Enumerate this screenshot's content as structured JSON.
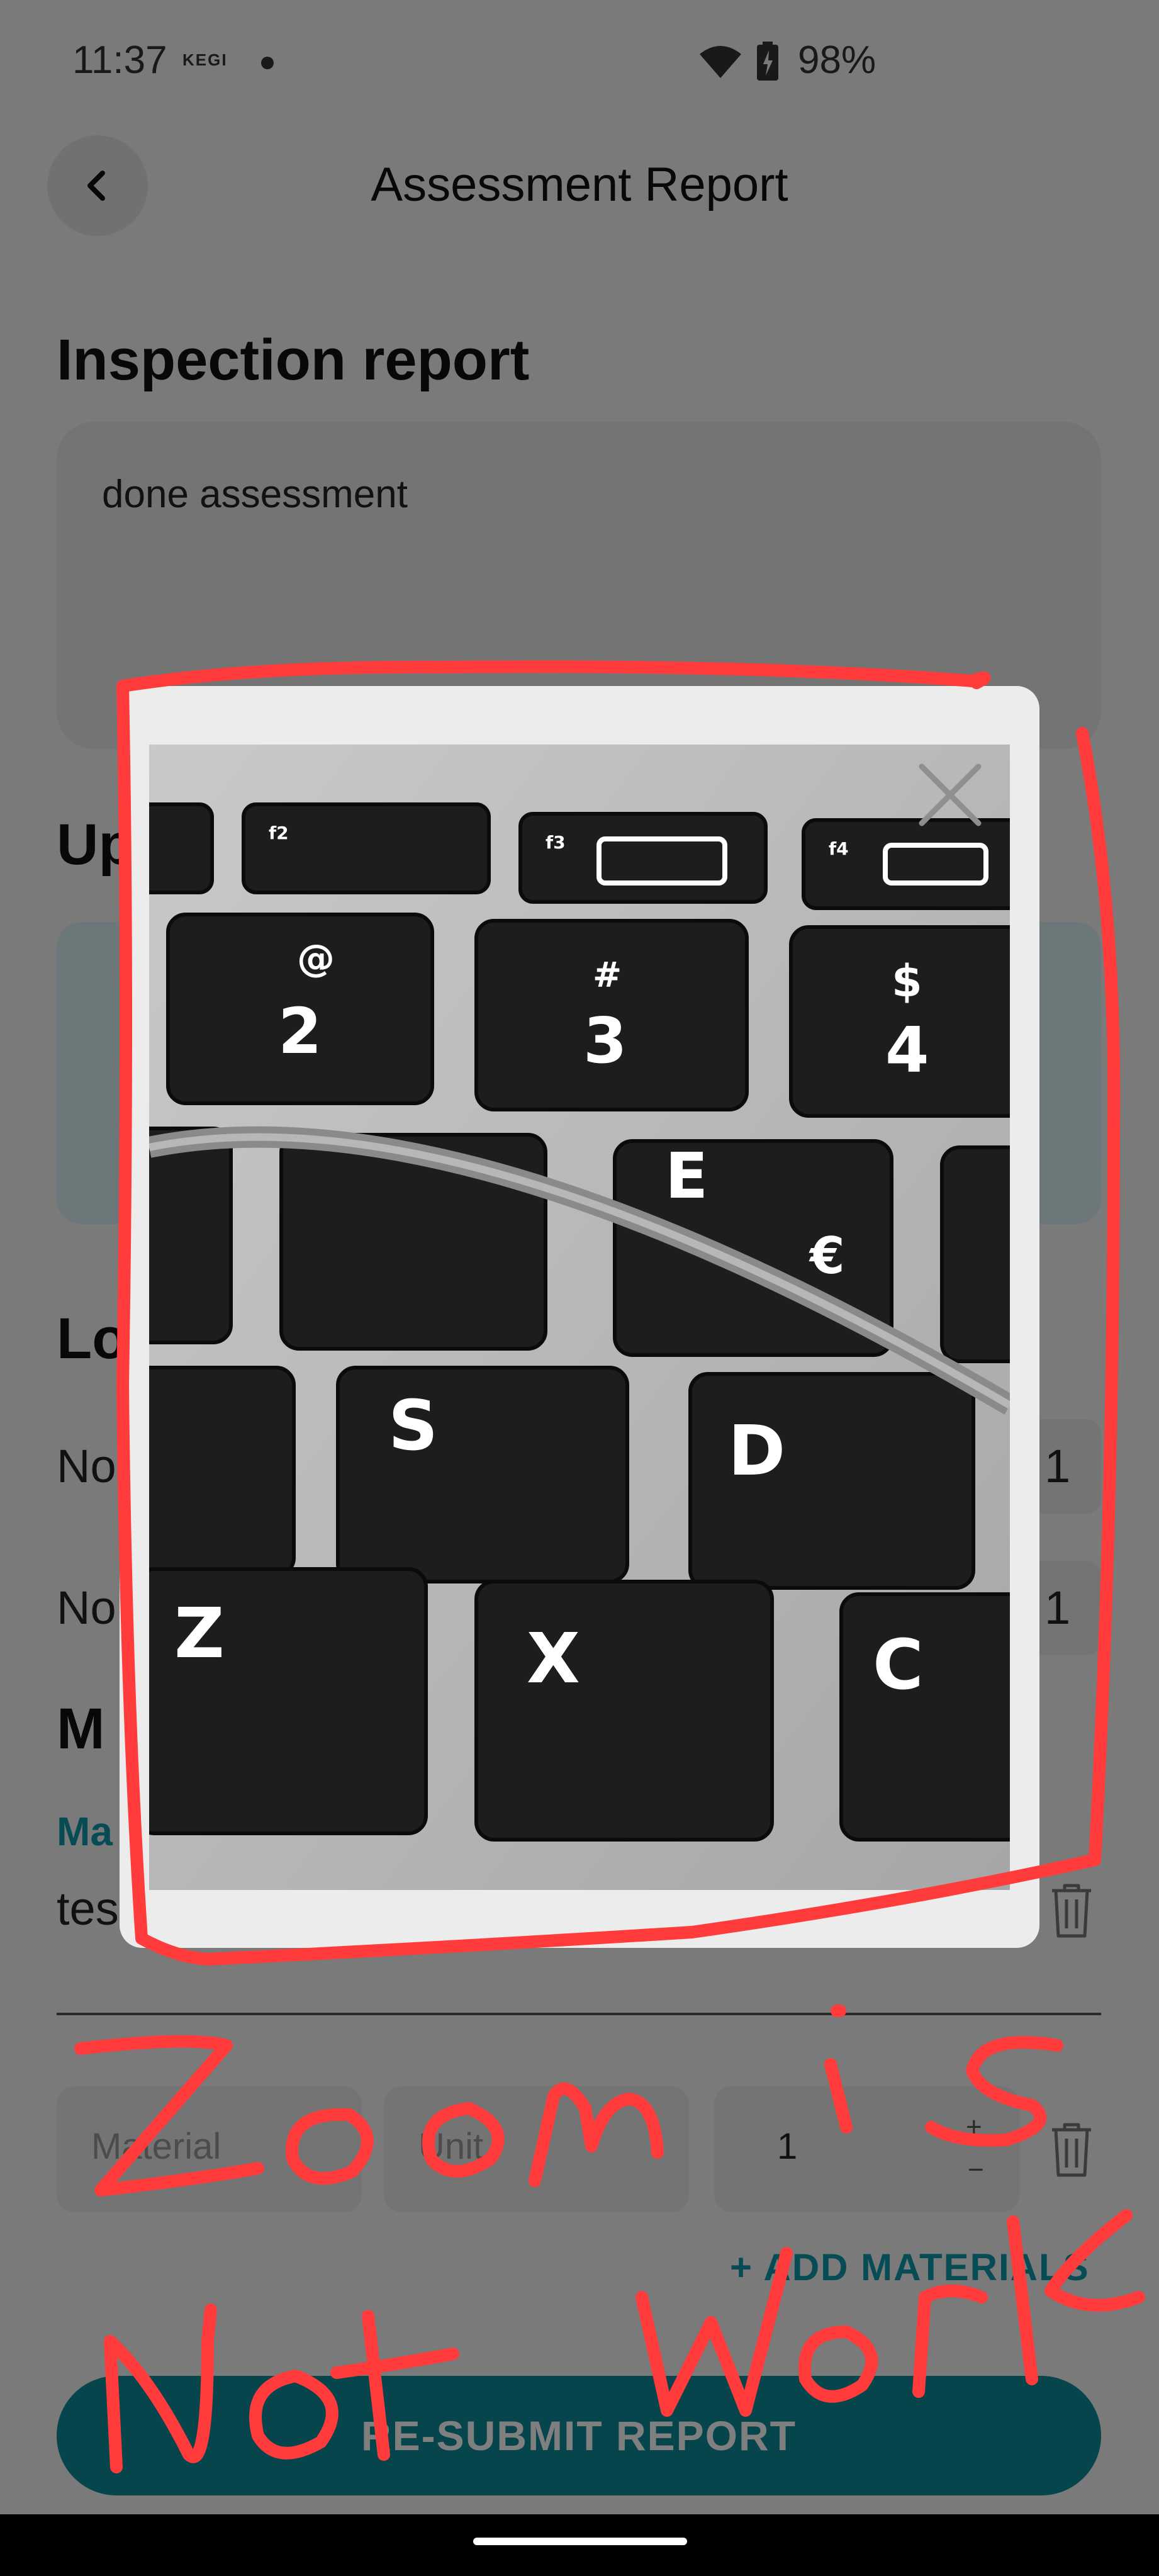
{
  "status_bar": {
    "time": "11:37",
    "carrier": "KEGI",
    "battery": "98%"
  },
  "header": {
    "title": "Assessment Report"
  },
  "inspection": {
    "heading": "Inspection report",
    "value": "done assessment"
  },
  "upload": {
    "heading_visible": "Up"
  },
  "location": {
    "heading_visible": "Lo",
    "rows": [
      {
        "label_visible": "No",
        "value_visible": "1"
      },
      {
        "label_visible": "No",
        "value_visible": "1"
      }
    ]
  },
  "materials": {
    "heading_visible": "M",
    "link_visible": "Ma",
    "item_visible": "tes",
    "material_placeholder": "Material",
    "unit_placeholder": "Unit",
    "quantity": "1",
    "add_label": "+ ADD MATERIALS"
  },
  "submit_label": "RE-SUBMIT REPORT",
  "annotation": {
    "line1": "Zoom is",
    "line2": "Not work"
  },
  "colors": {
    "accent": "#0f98a8",
    "submit": "#0e8b98",
    "annotation": "#ff3b3b",
    "scrim": "rgba(0,0,0,0.5)"
  },
  "icons": {
    "back": "chevron-left-icon",
    "close": "close-icon",
    "trash": "trash-icon",
    "wifi": "wifi-icon",
    "battery": "battery-charging-icon"
  }
}
